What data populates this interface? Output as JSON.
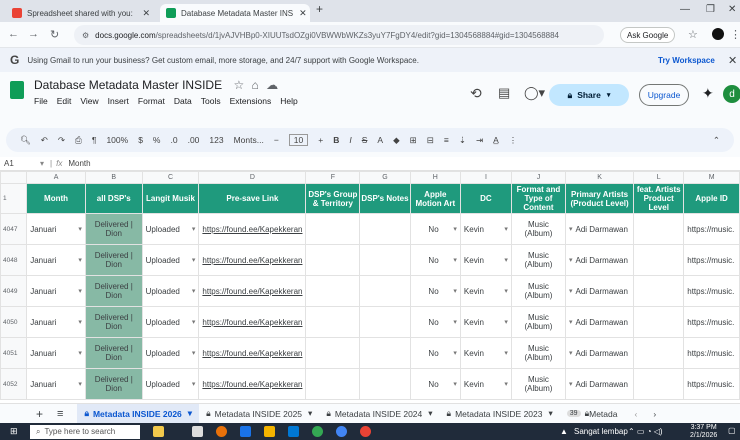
{
  "browser": {
    "tabs": [
      {
        "title": "Spreadsheet shared with you:",
        "active": false
      },
      {
        "title": "Database Metadata Master INS",
        "active": true
      }
    ],
    "url_host": "docs.google.com",
    "url_rest": "/spreadsheets/d/1jvAJVHBp0-XIUUTsdOZgi0VBWWbWKZs3yuY7FgDY4/edit?gid=1304568884#gid=1304568884",
    "ask_google": "Ask Google"
  },
  "banner": {
    "text": "Using Gmail to run your business? Get custom email, more storage, and 24/7 support with Google Workspace.",
    "cta": "Try Workspace"
  },
  "doc": {
    "title": "Database Metadata Master INSIDE",
    "menus": [
      "File",
      "Edit",
      "View",
      "Insert",
      "Format",
      "Data",
      "Tools",
      "Extensions",
      "Help"
    ],
    "share_label": "Share",
    "upgrade_label": "Upgrade",
    "avatar_letter": "d"
  },
  "toolbar": {
    "zoom": "100%",
    "currency": "$",
    "percent": "%",
    "dec_dec": ".0",
    "dec_inc": ".00",
    "numfmt": "123",
    "font": "Monts...",
    "font_size": "10"
  },
  "formula": {
    "cell_ref": "A1",
    "fx": "fx",
    "value": "Month"
  },
  "grid": {
    "col_letters": [
      "A",
      "B",
      "C",
      "D",
      "F",
      "G",
      "H",
      "I",
      "J",
      "K",
      "L",
      "M"
    ],
    "header_row_num": "1",
    "headers": [
      "Month",
      "all DSP's",
      "Langit Musik",
      "Pre-save Link",
      "DSP's Group & Territory",
      "DSP's Notes",
      "Apple Motion Art",
      "DC",
      "Format and Type of Content",
      "Primary Artists (Product Level)",
      "feat. Artists Product Level",
      "Apple ID"
    ],
    "rows": [
      {
        "num": "4047",
        "month": "Januari",
        "dsp": "Delivered | Dion",
        "langit": "Uploaded",
        "link": "https://found.ee/Kapekkeran",
        "motion": "No",
        "dc": "Kevin",
        "format": "Music (Album)",
        "artist": "Adi Darmawan",
        "apple": "https://music."
      },
      {
        "num": "4048",
        "month": "Januari",
        "dsp": "Delivered | Dion",
        "langit": "Uploaded",
        "link": "https://found.ee/Kapekkeran",
        "motion": "No",
        "dc": "Kevin",
        "format": "Music (Album)",
        "artist": "Adi Darmawan",
        "apple": "https://music."
      },
      {
        "num": "4049",
        "month": "Januari",
        "dsp": "Delivered | Dion",
        "langit": "Uploaded",
        "link": "https://found.ee/Kapekkeran",
        "motion": "No",
        "dc": "Kevin",
        "format": "Music (Album)",
        "artist": "Adi Darmawan",
        "apple": "https://music."
      },
      {
        "num": "4050",
        "month": "Januari",
        "dsp": "Delivered | Dion",
        "langit": "Uploaded",
        "link": "https://found.ee/Kapekkeran",
        "motion": "No",
        "dc": "Kevin",
        "format": "Music (Album)",
        "artist": "Adi Darmawan",
        "apple": "https://music."
      },
      {
        "num": "4051",
        "month": "Januari",
        "dsp": "Delivered | Dion",
        "langit": "Uploaded",
        "link": "https://found.ee/Kapekkeran",
        "motion": "No",
        "dc": "Kevin",
        "format": "Music (Album)",
        "artist": "Adi Darmawan",
        "apple": "https://music."
      },
      {
        "num": "4052",
        "month": "Januari",
        "dsp": "Delivered | Dion",
        "langit": "Uploaded",
        "link": "https://found.ee/Kapekkeran",
        "motion": "No",
        "dc": "Kevin",
        "format": "Music (Album)",
        "artist": "Adi Darmawan",
        "apple": "https://music."
      }
    ]
  },
  "sheet_tabs": [
    "Metadata INSIDE 2026",
    "Metadata INSIDE 2025",
    "Metadata INSIDE 2024",
    "Metadata INSIDE 2023",
    "Metada"
  ],
  "hidden_count": "39",
  "taskbar": {
    "search_placeholder": "Type here to search",
    "weather": "Sangat lembap",
    "time": "3:37 PM",
    "date": "2/1/2026"
  },
  "colors": {
    "header_green": "#1f9a7d",
    "dsp_green": "#87b9a5",
    "accent_blue": "#0b57d0"
  }
}
